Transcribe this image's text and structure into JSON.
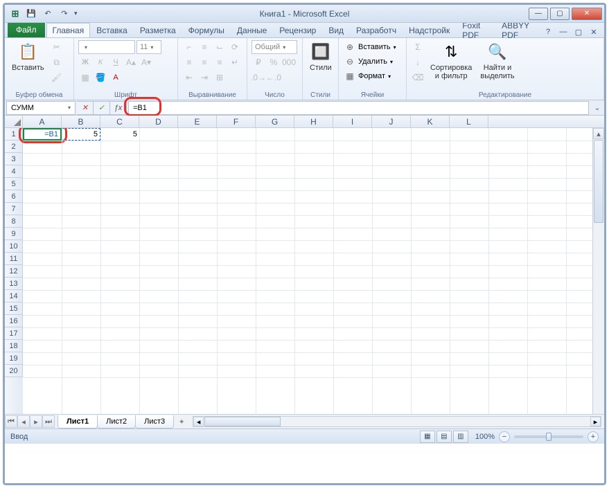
{
  "window": {
    "title": "Книга1  -  Microsoft Excel"
  },
  "tabs": {
    "file": "Файл",
    "items": [
      "Главная",
      "Вставка",
      "Разметка",
      "Формулы",
      "Данные",
      "Рецензир",
      "Вид",
      "Разработч",
      "Надстройк",
      "Foxit PDF",
      "ABBYY PDF"
    ],
    "active_index": 0
  },
  "ribbon": {
    "clipboard": {
      "paste": "Вставить",
      "label": "Буфер обмена"
    },
    "font": {
      "name": "",
      "size": "11",
      "label": "Шрифт"
    },
    "alignment": {
      "label": "Выравнивание"
    },
    "number": {
      "format_label": "Общий",
      "label": "Число"
    },
    "styles": {
      "styles": "Стили",
      "label": "Стили"
    },
    "cells": {
      "insert": "Вставить",
      "delete": "Удалить",
      "format": "Формат",
      "label": "Ячейки"
    },
    "editing": {
      "sort": "Сортировка\nи фильтр",
      "find": "Найти и\nвыделить",
      "label": "Редактирование"
    }
  },
  "formula_bar": {
    "name_box": "СУММ",
    "formula": "=B1"
  },
  "grid": {
    "columns": [
      "A",
      "B",
      "C",
      "D",
      "E",
      "F",
      "G",
      "H",
      "I",
      "J",
      "K",
      "L"
    ],
    "row_count": 20,
    "cells": {
      "A1": {
        "value": "=B1",
        "editing": true
      },
      "B1": {
        "value": "5",
        "ref": true
      },
      "C1": {
        "value": "5"
      }
    }
  },
  "sheets": {
    "items": [
      "Лист1",
      "Лист2",
      "Лист3"
    ],
    "active_index": 0
  },
  "status": {
    "mode": "Ввод",
    "zoom": "100%"
  }
}
